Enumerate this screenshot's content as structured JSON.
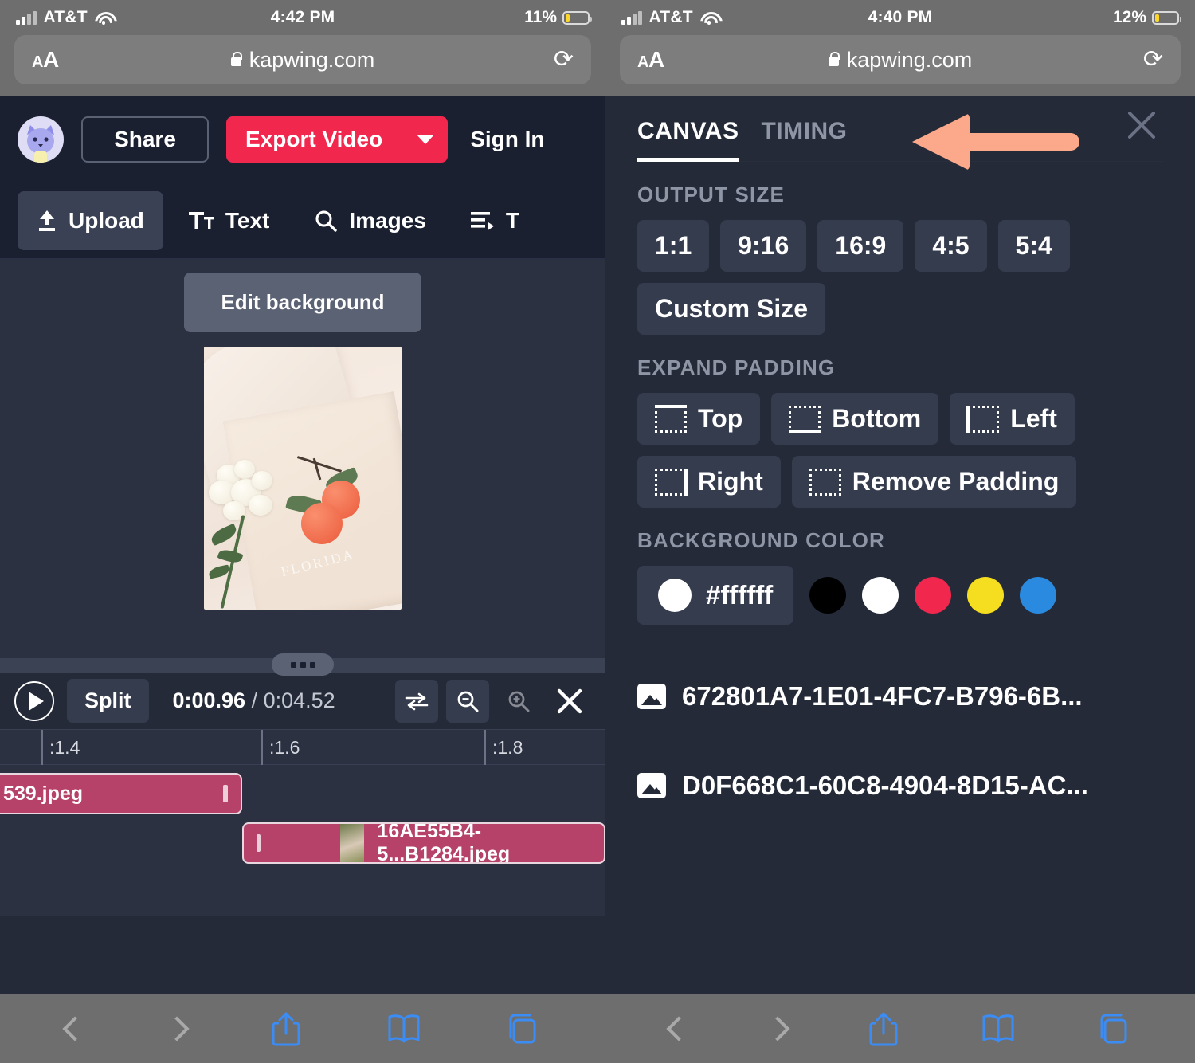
{
  "left": {
    "status": {
      "carrier": "AT&T",
      "time": "4:42 PM",
      "battery": "11%"
    },
    "browser": {
      "text_size_label": "AA",
      "url": "kapwing.com",
      "reload_icon": "reload-icon",
      "lock_icon": "lock-icon"
    },
    "topbar": {
      "avatar": "user-avatar",
      "share": "Share",
      "export": "Export Video",
      "export_caret_icon": "chevron-down-icon",
      "sign_in": "Sign In"
    },
    "tools": [
      {
        "label": "Upload",
        "icon": "upload-icon",
        "active": true
      },
      {
        "label": "Text",
        "icon": "text-icon",
        "active": false
      },
      {
        "label": "Images",
        "icon": "search-icon",
        "active": false
      },
      {
        "label": "T",
        "icon": "timeline-icon",
        "active": false
      }
    ],
    "canvas": {
      "edit_background": "Edit background",
      "preview_alt": "tote bag with white flowers and oranges, FLORIDA print",
      "photo_caption": "FLORIDA"
    },
    "annotation_arrow": "down-arrow-annotation",
    "timeline": {
      "grip_icon": "drag-handle-icon",
      "play_icon": "play-icon",
      "split": "Split",
      "current_time": "0:00.96",
      "separator": " / ",
      "total_time": "0:04.52",
      "fit_icon": "fit-to-screen-icon",
      "zoom_out_icon": "zoom-out-icon",
      "zoom_in_icon": "zoom-in-icon",
      "close_icon": "close-icon",
      "ruler_ticks": [
        ":1.4",
        ":1.6",
        ":1.8"
      ],
      "clips": [
        {
          "name": "539.jpeg",
          "has_thumb": false
        },
        {
          "name": "16AE55B4-5...B1284.jpeg",
          "has_thumb": true
        }
      ]
    },
    "bottom_nav": [
      "back-icon",
      "forward-icon",
      "share-icon",
      "bookmarks-icon",
      "tabs-icon"
    ]
  },
  "right": {
    "status": {
      "carrier": "AT&T",
      "time": "4:40 PM",
      "battery": "12%"
    },
    "browser": {
      "text_size_label": "AA",
      "url": "kapwing.com",
      "reload_icon": "reload-icon",
      "lock_icon": "lock-icon"
    },
    "tabs": [
      {
        "label": "CANVAS",
        "active": true
      },
      {
        "label": "TIMING",
        "active": false
      }
    ],
    "close_icon": "close-icon",
    "annotation_arrow": "left-arrow-annotation",
    "output_size": {
      "heading": "OUTPUT SIZE",
      "ratios": [
        "1:1",
        "9:16",
        "16:9",
        "4:5",
        "5:4"
      ],
      "custom": "Custom Size"
    },
    "expand_padding": {
      "heading": "EXPAND PADDING",
      "options": [
        {
          "label": "Top",
          "icon": "padding-top-icon",
          "side": "top"
        },
        {
          "label": "Bottom",
          "icon": "padding-bottom-icon",
          "side": "bottom"
        },
        {
          "label": "Left",
          "icon": "padding-left-icon",
          "side": "left"
        },
        {
          "label": "Right",
          "icon": "padding-right-icon",
          "side": "right"
        },
        {
          "label": "Remove Padding",
          "icon": "remove-padding-icon",
          "side": "none"
        }
      ]
    },
    "background_color": {
      "heading": "BACKGROUND COLOR",
      "hex": "#ffffff",
      "presets": [
        "#000000",
        "#ffffff",
        "#f1274e",
        "#f5dd20",
        "#2a8ae0"
      ]
    },
    "files": [
      "672801A7-1E01-4FC7-B796-6B...",
      "D0F668C1-60C8-4904-8D15-AC..."
    ],
    "bottom_nav": [
      "back-icon",
      "forward-icon",
      "share-icon",
      "bookmarks-icon",
      "tabs-icon"
    ]
  }
}
